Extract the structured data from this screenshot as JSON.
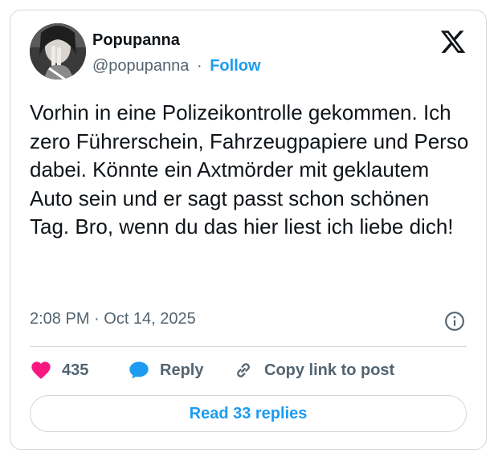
{
  "author": {
    "display_name": "Popupanna",
    "handle": "@popupanna",
    "separator": "·",
    "follow_label": "Follow"
  },
  "icons": {
    "brand": "x-logo-icon",
    "info": "info-icon",
    "like": "heart-icon",
    "reply": "speech-bubble-icon",
    "copy": "link-icon"
  },
  "tweet": {
    "text": "Vorhin in eine Polizeikontrolle gekommen. Ich zero Führerschein, Fahrzeugpapiere und Perso dabei. Könnte ein Axtmörder mit geklautem Auto sein und er sagt passt schon schönen Tag. Bro, wenn du das hier liest ich liebe dich!",
    "timestamp": "2:08 PM · Oct 14, 2025"
  },
  "actions": {
    "like_count": "435",
    "reply_label": "Reply",
    "copy_label": "Copy link to post"
  },
  "footer": {
    "read_replies_label": "Read 33 replies"
  },
  "colors": {
    "accent": "#1d9bf0",
    "like": "#f91880",
    "text": "#0f1419",
    "muted": "#536471",
    "border": "#cfd9de"
  }
}
